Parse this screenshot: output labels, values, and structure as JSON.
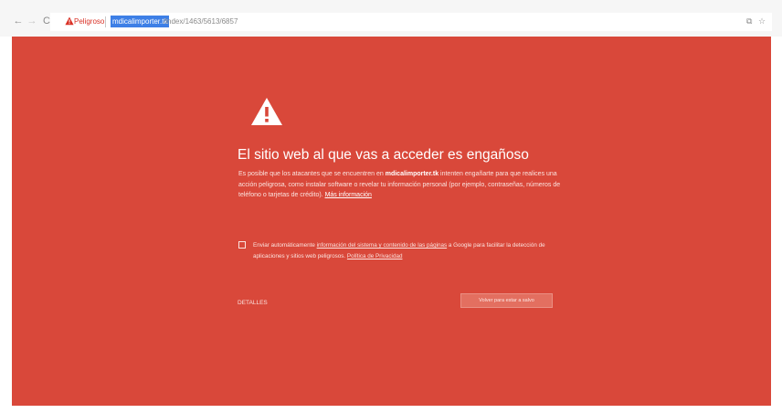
{
  "toolbar": {
    "back_glyph": "←",
    "forward_glyph": "→",
    "reload_glyph": "C",
    "security_label": "Peligroso",
    "url_host": "mdicalimporter.tk",
    "url_path": "/index/1463/5613/6857",
    "translate_glyph": "⧉",
    "star_glyph": "☆",
    "icons": {
      "back": "back-arrow-icon",
      "forward": "forward-arrow-icon",
      "reload": "reload-icon",
      "security": "warning-triangle-icon",
      "translate": "translate-icon",
      "bookmark": "bookmark-star-icon"
    }
  },
  "interstitial": {
    "background_color": "#d9483a",
    "icon": "warning-triangle-icon",
    "headline": "El sitio web al que vas a acceder es engañoso",
    "body_prefix": "Es posible que los atacantes que se encuentren en ",
    "body_host": "mdicalimporter.tk",
    "body_suffix": " intenten engañarte para que realices una acción peligrosa, como instalar software o revelar tu información personal (por ejemplo, contraseñas, números de teléfono o tarjetas de crédito). ",
    "more_link": "Más información",
    "optin_prefix": "Enviar automáticamente ",
    "optin_link": "información del sistema y contenido de las páginas",
    "optin_middle": " a Google para facilitar la detección de aplicaciones y sitios web peligrosos. ",
    "privacy_link": "Política de Privacidad",
    "details_button": "DETALLES",
    "safety_button": "Volver para estar a salvo"
  }
}
